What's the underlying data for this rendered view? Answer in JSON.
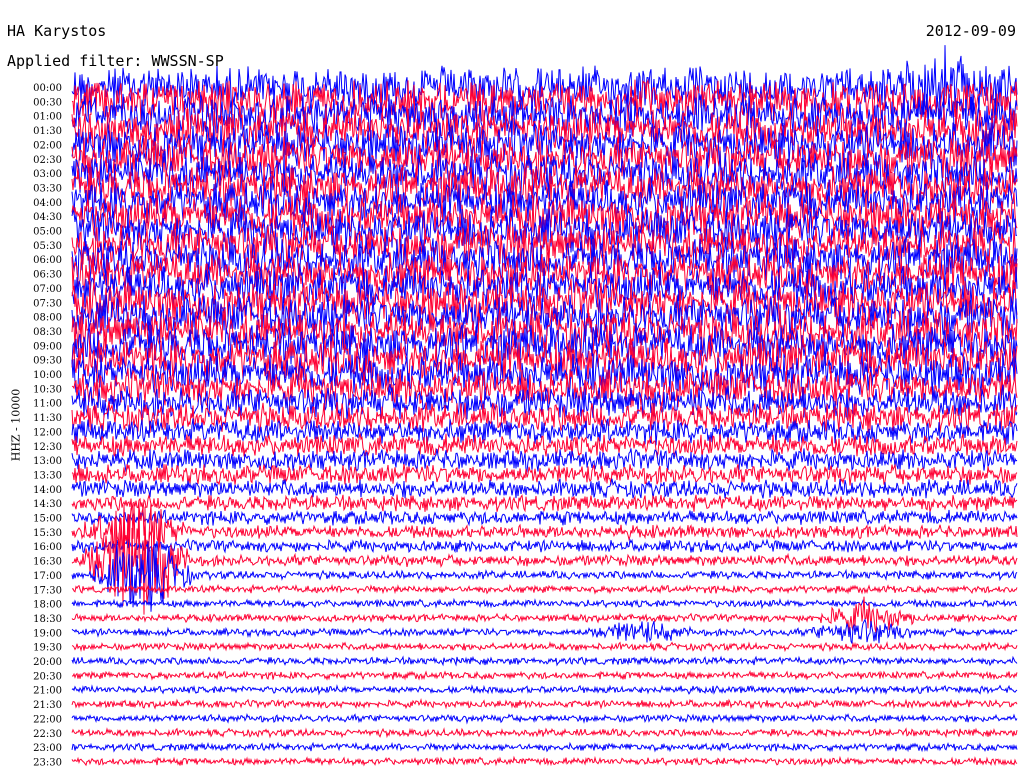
{
  "header": {
    "station": "HA Karystos",
    "date": "2012-09-09",
    "filter": "Applied filter: WWSSN-SP"
  },
  "chart_data": {
    "type": "helicorder",
    "title": "HA Karystos",
    "date": "2012-09-09",
    "filter": "WWSSN-SP",
    "ylabel": "HHZ - 10000",
    "row_labels": [
      "00:00",
      "00:30",
      "01:00",
      "01:30",
      "02:00",
      "02:30",
      "03:00",
      "03:30",
      "04:00",
      "04:30",
      "05:00",
      "05:30",
      "06:00",
      "06:30",
      "07:00",
      "07:30",
      "08:00",
      "08:30",
      "09:00",
      "09:30",
      "10:00",
      "10:30",
      "11:00",
      "11:30",
      "12:00",
      "12:30",
      "13:00",
      "13:30",
      "14:00",
      "14:30",
      "15:00",
      "15:30",
      "16:00",
      "16:30",
      "17:00",
      "17:30",
      "18:00",
      "18:30",
      "19:00",
      "19:30",
      "20:00",
      "20:30",
      "21:00",
      "21:30",
      "22:00",
      "22:30",
      "23:00",
      "23:30"
    ],
    "trace_colors": [
      "#0000ff",
      "#ff0033"
    ],
    "noise_level": [
      1.0,
      1.0,
      1.0,
      1.0,
      1.0,
      1.0,
      1.0,
      1.0,
      1.0,
      1.0,
      1.0,
      1.0,
      1.0,
      1.0,
      1.0,
      1.0,
      1.0,
      1.0,
      1.0,
      1.0,
      0.95,
      0.85,
      0.75,
      0.65,
      0.55,
      0.5,
      0.45,
      0.42,
      0.38,
      0.32,
      0.28,
      0.25,
      0.22,
      0.2,
      0.12,
      0.1,
      0.1,
      0.1,
      0.1,
      0.1,
      0.1,
      0.1,
      0.1,
      0.1,
      0.1,
      0.1,
      0.1,
      0.1
    ],
    "events": [
      {
        "row": 31,
        "minute": 2.0,
        "amplitude": 6.0
      },
      {
        "row": 33,
        "minute": 2.0,
        "amplitude": 14.0
      },
      {
        "row": 34,
        "minute": 2.2,
        "amplitude": 8.0
      },
      {
        "row": 37,
        "minute": 25.2,
        "amplitude": 3.0
      },
      {
        "row": 38,
        "minute": 18.0,
        "amplitude": 2.0
      },
      {
        "row": 38,
        "minute": 25.0,
        "amplitude": 2.5
      },
      {
        "row": 0,
        "minute": 27.8,
        "amplitude": 4.0
      }
    ]
  }
}
